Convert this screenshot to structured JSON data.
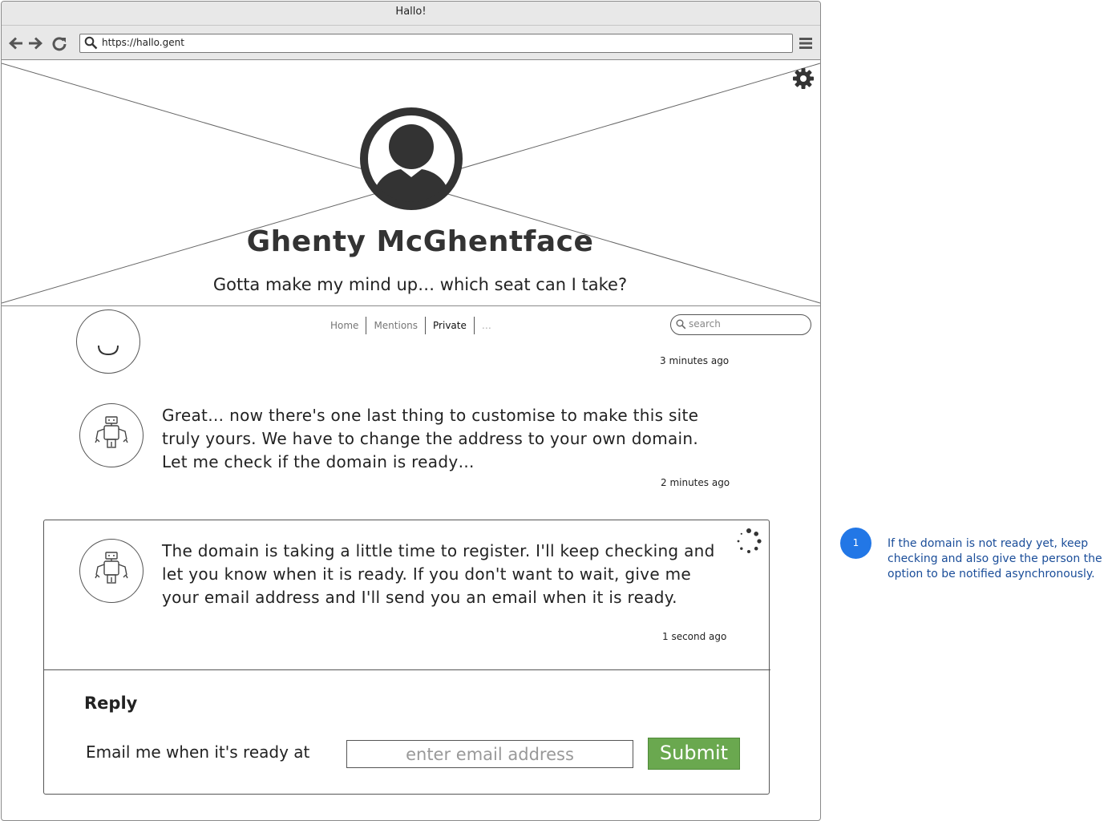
{
  "window": {
    "title": "Hallo!"
  },
  "browser": {
    "url": "https://hallo.gent"
  },
  "hero": {
    "name": "Ghenty McGhentface",
    "tagline": "Gotta make my mind up… which seat can I take?"
  },
  "nav": {
    "tabs": [
      {
        "label": "Home"
      },
      {
        "label": "Mentions"
      },
      {
        "label": "Private"
      },
      {
        "label": "…"
      }
    ],
    "search_placeholder": "search"
  },
  "messages": [
    {
      "text": "",
      "time": "3 minutes ago",
      "avatar": "robot-icon"
    },
    {
      "text": "Great… now there's one last thing to customise to make this site truly yours. We have to change the address to your own domain. Let me check if the domain is ready…",
      "time": "2 minutes ago",
      "avatar": "robot-icon"
    },
    {
      "text": "The domain is taking a little time to register. I'll keep checking and let you know when it is ready. If you don't want to wait, give me your email address and I'll send you an email when it is ready.",
      "time": "1 second ago",
      "avatar": "robot-icon"
    }
  ],
  "reply": {
    "heading": "Reply",
    "label": "Email me when it's ready at",
    "placeholder": "enter email address",
    "submit_label": "Submit"
  },
  "annotation": {
    "number": "1",
    "text": "If the domain is not ready yet, keep checking and also give the person the option to be notified asynchronously."
  },
  "colors": {
    "submit": "#6aa84f",
    "annotation_marker": "#2277e6",
    "annotation_text": "#1a4d99"
  }
}
